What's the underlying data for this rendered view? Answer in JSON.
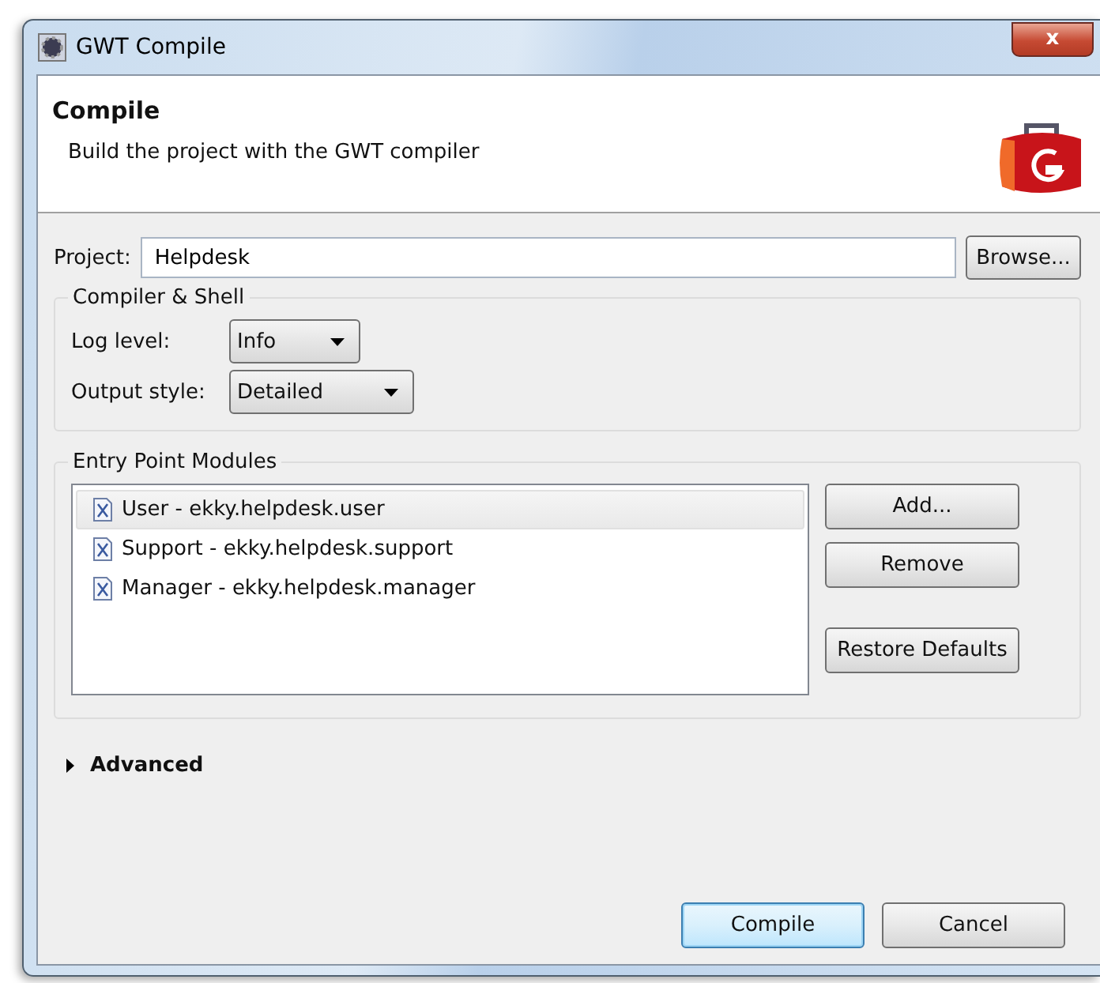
{
  "window": {
    "title": "GWT Compile",
    "close": "x"
  },
  "header": {
    "title": "Compile",
    "description": "Build the project with the GWT compiler"
  },
  "project": {
    "label": "Project:",
    "value": "Helpdesk",
    "button": "Browse..."
  },
  "compiler_shell": {
    "title": "Compiler & Shell",
    "fields": [
      {
        "label": "Log level:",
        "value": "Info"
      },
      {
        "label": "Output style:",
        "value": "Detailed"
      }
    ]
  },
  "entry_point_modules": {
    "title": "Entry Point Modules",
    "items": [
      {
        "label": "User - ekky.helpdesk.user",
        "selected": true
      },
      {
        "label": "Support - ekky.helpdesk.support",
        "selected": false
      },
      {
        "label": "Manager - ekky.helpdesk.manager",
        "selected": false
      }
    ],
    "buttons": [
      {
        "label": "Add...",
        "kind": "button"
      },
      {
        "label": "Remove",
        "kind": "button"
      },
      {
        "label": "Restore Defaults",
        "kind": "separated"
      }
    ]
  },
  "advanced": {
    "label": "Advanced",
    "expanded": false
  },
  "buttons": [
    {
      "label": "Compile",
      "default": true
    },
    {
      "label": "Cancel",
      "default": false
    }
  ]
}
